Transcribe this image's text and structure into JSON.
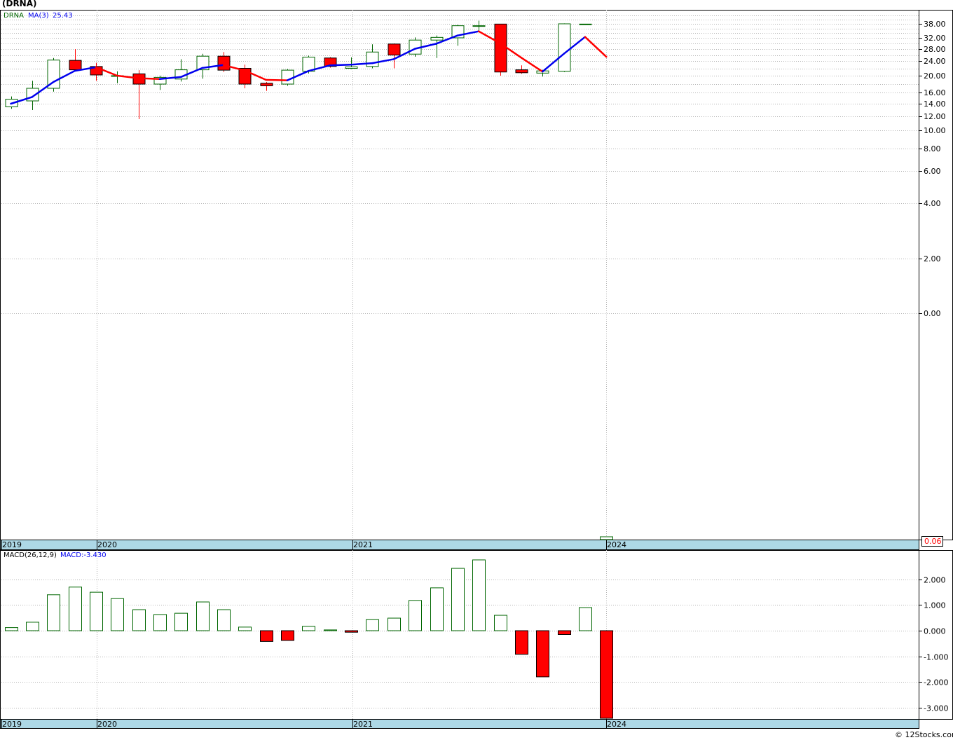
{
  "title": "(DRNA)",
  "watermark": "© 12Stocks.com",
  "colors": {
    "up": "#006600",
    "down": "#ff0000",
    "ma_up": "#0000ee",
    "ma_down": "#ff0000",
    "band": "#add8e6",
    "grid": "#b4b4b4",
    "text": "#000000"
  },
  "chart_data": [
    {
      "type": "candlestick",
      "legend": {
        "symbol": "DRNA",
        "ma_label": "MA(3)",
        "ma_value": "25.43"
      },
      "x_tick_labels": [
        "2019",
        "2020",
        "2021",
        "2024"
      ],
      "y_tick_labels": [
        "38.00",
        "32.00",
        "28.00",
        "24.00",
        "20.00",
        "16.00",
        "14.00",
        "12.00",
        "10.00",
        "8.00",
        "6.00",
        "4.00",
        "2.00",
        "0.00"
      ],
      "last_value_label": "0.06",
      "candles": [
        {
          "open": 13.5,
          "close": 14.8,
          "high": 15.3,
          "low": 13.2
        },
        {
          "open": 14.5,
          "close": 17.0,
          "high": 18.8,
          "low": 13.0
        },
        {
          "open": 17.0,
          "close": 24.3,
          "high": 25.0,
          "low": 16.2
        },
        {
          "open": 24.2,
          "close": 21.6,
          "high": 28.0,
          "low": 21.3
        },
        {
          "open": 22.5,
          "close": 20.2,
          "high": 23.5,
          "low": 18.8
        },
        {
          "open": 20.0,
          "close": 20.0,
          "high": 21.2,
          "low": 18.2
        },
        {
          "open": 20.5,
          "close": 18.0,
          "high": 21.5,
          "low": 11.6
        },
        {
          "open": 18.0,
          "close": 19.6,
          "high": 20.0,
          "low": 16.6
        },
        {
          "open": 19.2,
          "close": 21.6,
          "high": 24.6,
          "low": 18.6
        },
        {
          "open": 21.6,
          "close": 25.6,
          "high": 26.4,
          "low": 19.3
        },
        {
          "open": 25.6,
          "close": 21.5,
          "high": 27.0,
          "low": 21.0
        },
        {
          "open": 22.0,
          "close": 18.0,
          "high": 23.0,
          "low": 17.0
        },
        {
          "open": 18.2,
          "close": 17.6,
          "high": 18.5,
          "low": 16.4
        },
        {
          "open": 18.0,
          "close": 21.5,
          "high": 21.8,
          "low": 17.6
        },
        {
          "open": 21.2,
          "close": 25.3,
          "high": 25.8,
          "low": 20.6
        },
        {
          "open": 25.0,
          "close": 22.5,
          "high": 25.3,
          "low": 22.2
        },
        {
          "open": 22.0,
          "close": 22.4,
          "high": 25.2,
          "low": 21.8
        },
        {
          "open": 22.5,
          "close": 27.0,
          "high": 29.7,
          "low": 22.0
        },
        {
          "open": 29.8,
          "close": 26.0,
          "high": 30.0,
          "low": 22.0
        },
        {
          "open": 26.3,
          "close": 31.2,
          "high": 32.2,
          "low": 25.4
        },
        {
          "open": 31.2,
          "close": 32.2,
          "high": 33.0,
          "low": 25.0
        },
        {
          "open": 32.0,
          "close": 37.2,
          "high": 37.6,
          "low": 29.2
        },
        {
          "open": 37.0,
          "close": 37.2,
          "high": 39.5,
          "low": 34.8
        },
        {
          "open": 37.9,
          "close": 21.0,
          "high": 38.0,
          "low": 20.0
        },
        {
          "open": 21.6,
          "close": 20.8,
          "high": 22.8,
          "low": 20.5
        },
        {
          "open": 20.7,
          "close": 21.3,
          "high": 21.6,
          "low": 19.8
        },
        {
          "open": 21.2,
          "close": 38.0,
          "high": 38.2,
          "low": 21.0
        },
        {
          "open": 37.8,
          "close": 37.9,
          "high": 37.9,
          "low": 37.7
        }
      ],
      "ma": [
        14.0,
        15.2,
        18.5,
        21.3,
        22.3,
        20.0,
        19.4,
        19.2,
        19.7,
        22.1,
        22.9,
        21.4,
        19.0,
        18.9,
        21.3,
        22.8,
        23.0,
        23.4,
        24.6,
        28.1,
        29.9,
        33.0,
        34.8,
        30.1,
        25.1,
        21.1,
        26.4,
        32.4,
        25.4
      ]
    },
    {
      "type": "bar",
      "legend": {
        "label": "MACD(26,12,9)",
        "value_label": "MACD:-3.430"
      },
      "x_tick_labels": [
        "2019",
        "2020",
        "2021",
        "2024"
      ],
      "y_tick_labels": [
        "2.000",
        "1.000",
        "0.000",
        "-1.000",
        "-2.000",
        "-3.000"
      ],
      "ylim": [
        -3.4,
        2.8
      ],
      "values": [
        0.12,
        0.33,
        1.4,
        1.7,
        1.5,
        1.25,
        0.82,
        0.63,
        0.68,
        1.12,
        0.82,
        0.14,
        -0.42,
        -0.38,
        0.17,
        0.03,
        -0.06,
        0.43,
        0.49,
        1.18,
        1.67,
        2.43,
        2.76,
        0.6,
        -0.92,
        -1.8,
        -0.15,
        0.9,
        -3.43
      ]
    }
  ]
}
